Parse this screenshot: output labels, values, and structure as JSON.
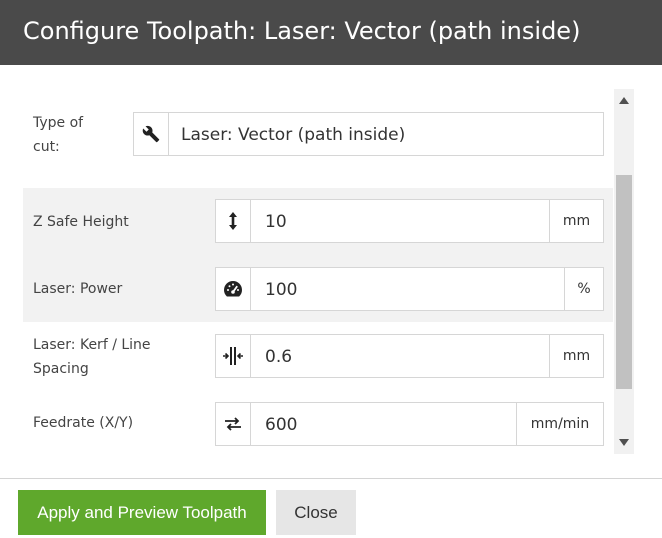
{
  "dialog": {
    "title": "Configure Toolpath: Laser: Vector (path inside)"
  },
  "fields": {
    "type_of_cut": {
      "label": "Type of cut:",
      "value": "Laser: Vector (path inside)",
      "icon": "wrench-icon"
    },
    "z_safe_height": {
      "label": "Z Safe Height",
      "value": "10",
      "unit": "mm",
      "icon": "vertical-arrows-icon"
    },
    "laser_power": {
      "label": "Laser: Power",
      "value": "100",
      "unit": "%",
      "icon": "gauge-icon"
    },
    "laser_kerf": {
      "label": "Laser: Kerf / Line Spacing",
      "value": "0.6",
      "unit": "mm",
      "icon": "kerf-icon"
    },
    "feedrate": {
      "label": "Feedrate (X/Y)",
      "value": "600",
      "unit": "mm/min",
      "icon": "swap-arrows-icon"
    }
  },
  "footer": {
    "apply_label": "Apply and Preview Toolpath",
    "close_label": "Close"
  },
  "colors": {
    "header_bg": "#4a4a4a",
    "primary_button": "#5fa82c",
    "secondary_button": "#e6e6e6",
    "row_alt_bg": "#f2f2f2"
  }
}
